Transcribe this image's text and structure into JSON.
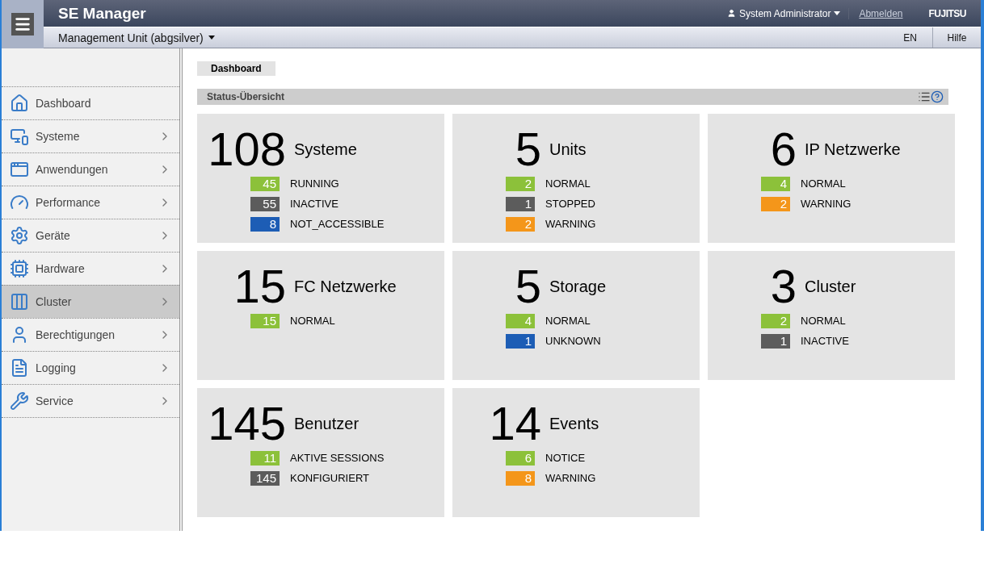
{
  "header": {
    "title": "SE Manager",
    "user": "System Administrator",
    "logout": "Abmelden",
    "logo": "FUJITSU"
  },
  "subbar": {
    "unit": "Management Unit (abgsilver)",
    "language": "EN",
    "help": "Hilfe"
  },
  "sidebar": {
    "items": [
      {
        "label": "Dashboard",
        "submenu": false,
        "selected": false
      },
      {
        "label": "Systeme",
        "submenu": true,
        "selected": false
      },
      {
        "label": "Anwendungen",
        "submenu": true,
        "selected": false
      },
      {
        "label": "Performance",
        "submenu": true,
        "selected": false
      },
      {
        "label": "Geräte",
        "submenu": true,
        "selected": false
      },
      {
        "label": "Hardware",
        "submenu": true,
        "selected": false
      },
      {
        "label": "Cluster",
        "submenu": true,
        "selected": true
      },
      {
        "label": "Berechtigungen",
        "submenu": true,
        "selected": false
      },
      {
        "label": "Logging",
        "submenu": true,
        "selected": false
      },
      {
        "label": "Service",
        "submenu": true,
        "selected": false
      }
    ]
  },
  "breadcrumb": "Dashboard",
  "section": {
    "title": "Status-Übersicht"
  },
  "tiles": [
    {
      "count": "108",
      "title": "Systeme",
      "statuses": [
        {
          "count": "45",
          "label": "RUNNING",
          "color": "#8cc13a"
        },
        {
          "count": "55",
          "label": "INACTIVE",
          "color": "#5c5c5c"
        },
        {
          "count": "8",
          "label": "NOT_ACCESSIBLE",
          "color": "#1d5db5"
        }
      ]
    },
    {
      "count": "5",
      "title": "Units",
      "statuses": [
        {
          "count": "2",
          "label": "NORMAL",
          "color": "#8cc13a"
        },
        {
          "count": "1",
          "label": "STOPPED",
          "color": "#5c5c5c"
        },
        {
          "count": "2",
          "label": "WARNING",
          "color": "#f4961a"
        }
      ]
    },
    {
      "count": "6",
      "title": "IP Netzwerke",
      "statuses": [
        {
          "count": "4",
          "label": "NORMAL",
          "color": "#8cc13a"
        },
        {
          "count": "2",
          "label": "WARNING",
          "color": "#f4961a"
        }
      ]
    },
    {
      "count": "15",
      "title": "FC Netzwerke",
      "statuses": [
        {
          "count": "15",
          "label": "NORMAL",
          "color": "#8cc13a"
        }
      ]
    },
    {
      "count": "5",
      "title": "Storage",
      "statuses": [
        {
          "count": "4",
          "label": "NORMAL",
          "color": "#8cc13a"
        },
        {
          "count": "1",
          "label": "UNKNOWN",
          "color": "#1d5db5"
        }
      ]
    },
    {
      "count": "3",
      "title": "Cluster",
      "statuses": [
        {
          "count": "2",
          "label": "NORMAL",
          "color": "#8cc13a"
        },
        {
          "count": "1",
          "label": "INACTIVE",
          "color": "#5c5c5c"
        }
      ]
    },
    {
      "count": "145",
      "title": "Benutzer",
      "statuses": [
        {
          "count": "11",
          "label": "AKTIVE SESSIONS",
          "color": "#8cc13a"
        },
        {
          "count": "145",
          "label": "KONFIGURIERT",
          "color": "#5c5c5c"
        }
      ]
    },
    {
      "count": "14",
      "title": "Events",
      "statuses": [
        {
          "count": "6",
          "label": "NOTICE",
          "color": "#8cc13a"
        },
        {
          "count": "8",
          "label": "WARNING",
          "color": "#f4961a"
        }
      ]
    }
  ]
}
